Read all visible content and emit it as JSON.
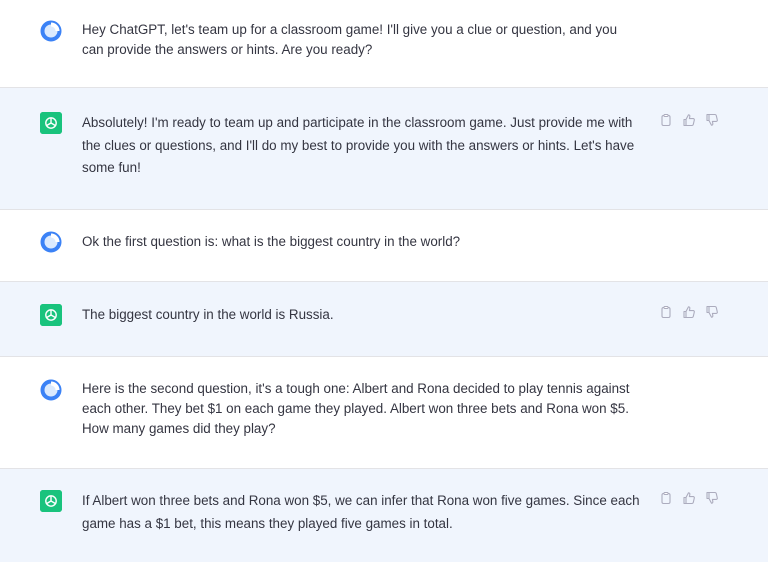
{
  "conversation": {
    "messages": [
      {
        "role": "user",
        "avatar_icon": "user-avatar-icon",
        "text": "Hey ChatGPT, let's team up for a classroom game! I'll give you a clue or question, and you can provide the answers or hints. Are you ready?"
      },
      {
        "role": "assistant",
        "avatar_icon": "chatgpt-logo-icon",
        "text": "Absolutely! I'm ready to team up and participate in the classroom game. Just provide me with the clues or questions, and I'll do my best to provide you with the answers or hints. Let's have some fun!"
      },
      {
        "role": "user",
        "avatar_icon": "user-avatar-icon",
        "text": "Ok the first question is: what is the biggest country in the world?"
      },
      {
        "role": "assistant",
        "avatar_icon": "chatgpt-logo-icon",
        "text": "The biggest country in the world is Russia."
      },
      {
        "role": "user",
        "avatar_icon": "user-avatar-icon",
        "text": "Here is the second question, it's a tough one: Albert and Rona decided to play tennis against each other. They bet $1 on each game they played. Albert won three bets and Rona won $5. How many games did they play?"
      },
      {
        "role": "assistant",
        "avatar_icon": "chatgpt-logo-icon",
        "text": "If Albert won three bets and Rona won $5, we can infer that Rona won five games. Since each game has a $1 bet, this means they played five games in total."
      }
    ],
    "action_icons": [
      "copy-icon",
      "thumbs-up-icon",
      "thumbs-down-icon"
    ]
  },
  "colors": {
    "user_background": "#ffffff",
    "assistant_background": "#f0f5fd",
    "assistant_logo": "#19c37d",
    "user_avatar_ring": "#3b82f6",
    "text": "#343541",
    "icon_gray": "#acacbe"
  }
}
